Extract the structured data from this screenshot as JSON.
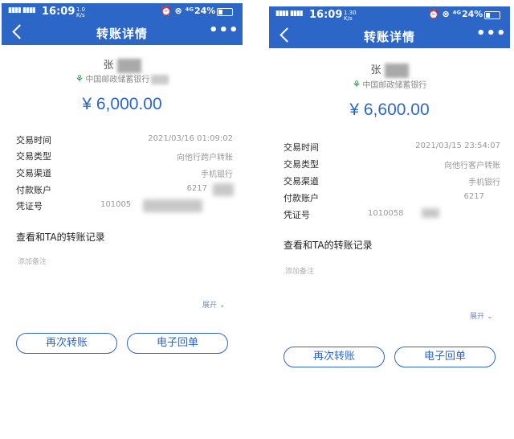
{
  "screens": [
    {
      "status": {
        "signal": "▮▮▮▮ ▮▮▮▮",
        "time": "16:09",
        "small_top": "1.0",
        "small_bottom": "K/s",
        "icons": "⏰ ⊗ ⁴ᴳ",
        "battery": "24%"
      },
      "header": {
        "title": "转账详情",
        "more": "•••"
      },
      "payee_name": "张",
      "bank_name": "中国邮政储蓄银行",
      "amount": "¥ 6,000.00",
      "details": [
        {
          "label": "交易时间",
          "value": "2021/03/16  01:09:02"
        },
        {
          "label": "交易类型",
          "value": "向他行跨户转账"
        },
        {
          "label": "交易渠道",
          "value": "手机银行"
        },
        {
          "label": "付款账户",
          "value": "6217"
        },
        {
          "label": "凭证号",
          "value": "101005"
        }
      ],
      "records_link": "查看和TA的转账记录",
      "remark_placeholder": "添加备注",
      "expand_label": "展开",
      "buttons": {
        "transfer_again": "再次转账",
        "e_receipt": "电子回单"
      }
    },
    {
      "status": {
        "signal": "▮▮▮▮ ▮▮▮▮",
        "time": "16:09",
        "small_top": "1.30",
        "small_bottom": "K/s",
        "icons": "⏰ ⊗ ⁴ᴳ",
        "battery": "24%"
      },
      "header": {
        "title": "转账详情",
        "more": "•••"
      },
      "payee_name": "张",
      "bank_name": "中国邮政储蓄银行",
      "amount": "¥ 6,600.00",
      "details": [
        {
          "label": "交易时间",
          "value": "2021/03/15  23:54:07"
        },
        {
          "label": "交易类型",
          "value": "向他行客户转账"
        },
        {
          "label": "交易渠道",
          "value": "手机银行"
        },
        {
          "label": "付款账户",
          "value": "6217"
        },
        {
          "label": "凭证号",
          "value": "1010058"
        }
      ],
      "records_link": "查看和TA的转账记录",
      "remark_placeholder": "添加备注",
      "expand_label": "展开",
      "buttons": {
        "transfer_again": "再次转账",
        "e_receipt": "电子回单"
      }
    }
  ],
  "colors": {
    "accent": "#2c67c7",
    "postal_green": "#1d8f3f"
  },
  "icons": {
    "back": "chevron-left-icon",
    "more": "more-dots-icon",
    "bank": "postal-bank-logo-icon",
    "expand": "chevron-down-icon",
    "battery": "battery-icon",
    "signal": "signal-icon"
  }
}
